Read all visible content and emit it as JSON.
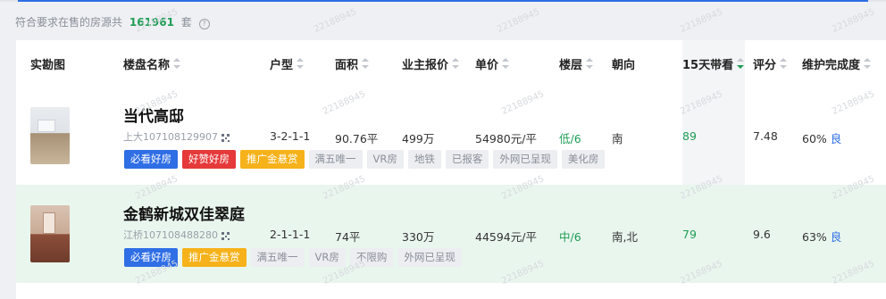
{
  "summary": {
    "prefix": "符合要求在售的房源共",
    "count": "161961",
    "suffix": "套",
    "help_icon": "?"
  },
  "columns": [
    {
      "label": "实勘图",
      "sortable": false
    },
    {
      "label": "楼盘名称",
      "sortable": true
    },
    {
      "label": "户型",
      "sortable": true
    },
    {
      "label": "面积",
      "sortable": true
    },
    {
      "label": "业主报价",
      "sortable": true
    },
    {
      "label": "单价",
      "sortable": true
    },
    {
      "label": "楼层",
      "sortable": true
    },
    {
      "label": "朝向",
      "sortable": false
    },
    {
      "label": "15天带看",
      "sortable": true,
      "active": "desc"
    },
    {
      "label": "评分",
      "sortable": true
    },
    {
      "label": "维护完成度",
      "sortable": true
    }
  ],
  "watermark": "22188945",
  "rows": [
    {
      "title": "当代高邸",
      "code": "上大107108129907",
      "layout": "3-2-1-1",
      "area": "90.76平",
      "price": "499万",
      "unit_price": "54980元/平",
      "floor": "低/6",
      "orientation": "南",
      "views": "89",
      "score": "7.48",
      "maintenance": "60%",
      "maintenance_grade": "良",
      "tags": [
        {
          "label": "必看好房",
          "style": "blue"
        },
        {
          "label": "好赞好房",
          "style": "red"
        },
        {
          "label": "推广金悬赏",
          "style": "orange"
        },
        {
          "label": "满五唯一",
          "style": "grey"
        },
        {
          "label": "VR房",
          "style": "grey"
        },
        {
          "label": "地铁",
          "style": "grey"
        },
        {
          "label": "已报客",
          "style": "grey"
        },
        {
          "label": "外网已呈现",
          "style": "grey"
        },
        {
          "label": "美化房",
          "style": "grey"
        }
      ]
    },
    {
      "title": "金鹤新城双佳翠庭",
      "code": "江桥107108488280",
      "layout": "2-1-1-1",
      "area": "74平",
      "price": "330万",
      "unit_price": "44594元/平",
      "floor": "中/6",
      "orientation": "南,北",
      "views": "79",
      "score": "9.6",
      "maintenance": "63%",
      "maintenance_grade": "良",
      "tags": [
        {
          "label": "必看好房",
          "style": "blue"
        },
        {
          "label": "推广金悬赏",
          "style": "orange"
        },
        {
          "label": "满五唯一",
          "style": "grey"
        },
        {
          "label": "VR房",
          "style": "grey"
        },
        {
          "label": "不限购",
          "style": "grey"
        },
        {
          "label": "外网已呈现",
          "style": "grey"
        }
      ]
    }
  ],
  "colors": {
    "accent_blue": "#2f6ee5",
    "green": "#1f9d55",
    "red_tag": "#e5393a",
    "orange_tag": "#f6b21a",
    "selected_row": "#e9f6ee"
  }
}
